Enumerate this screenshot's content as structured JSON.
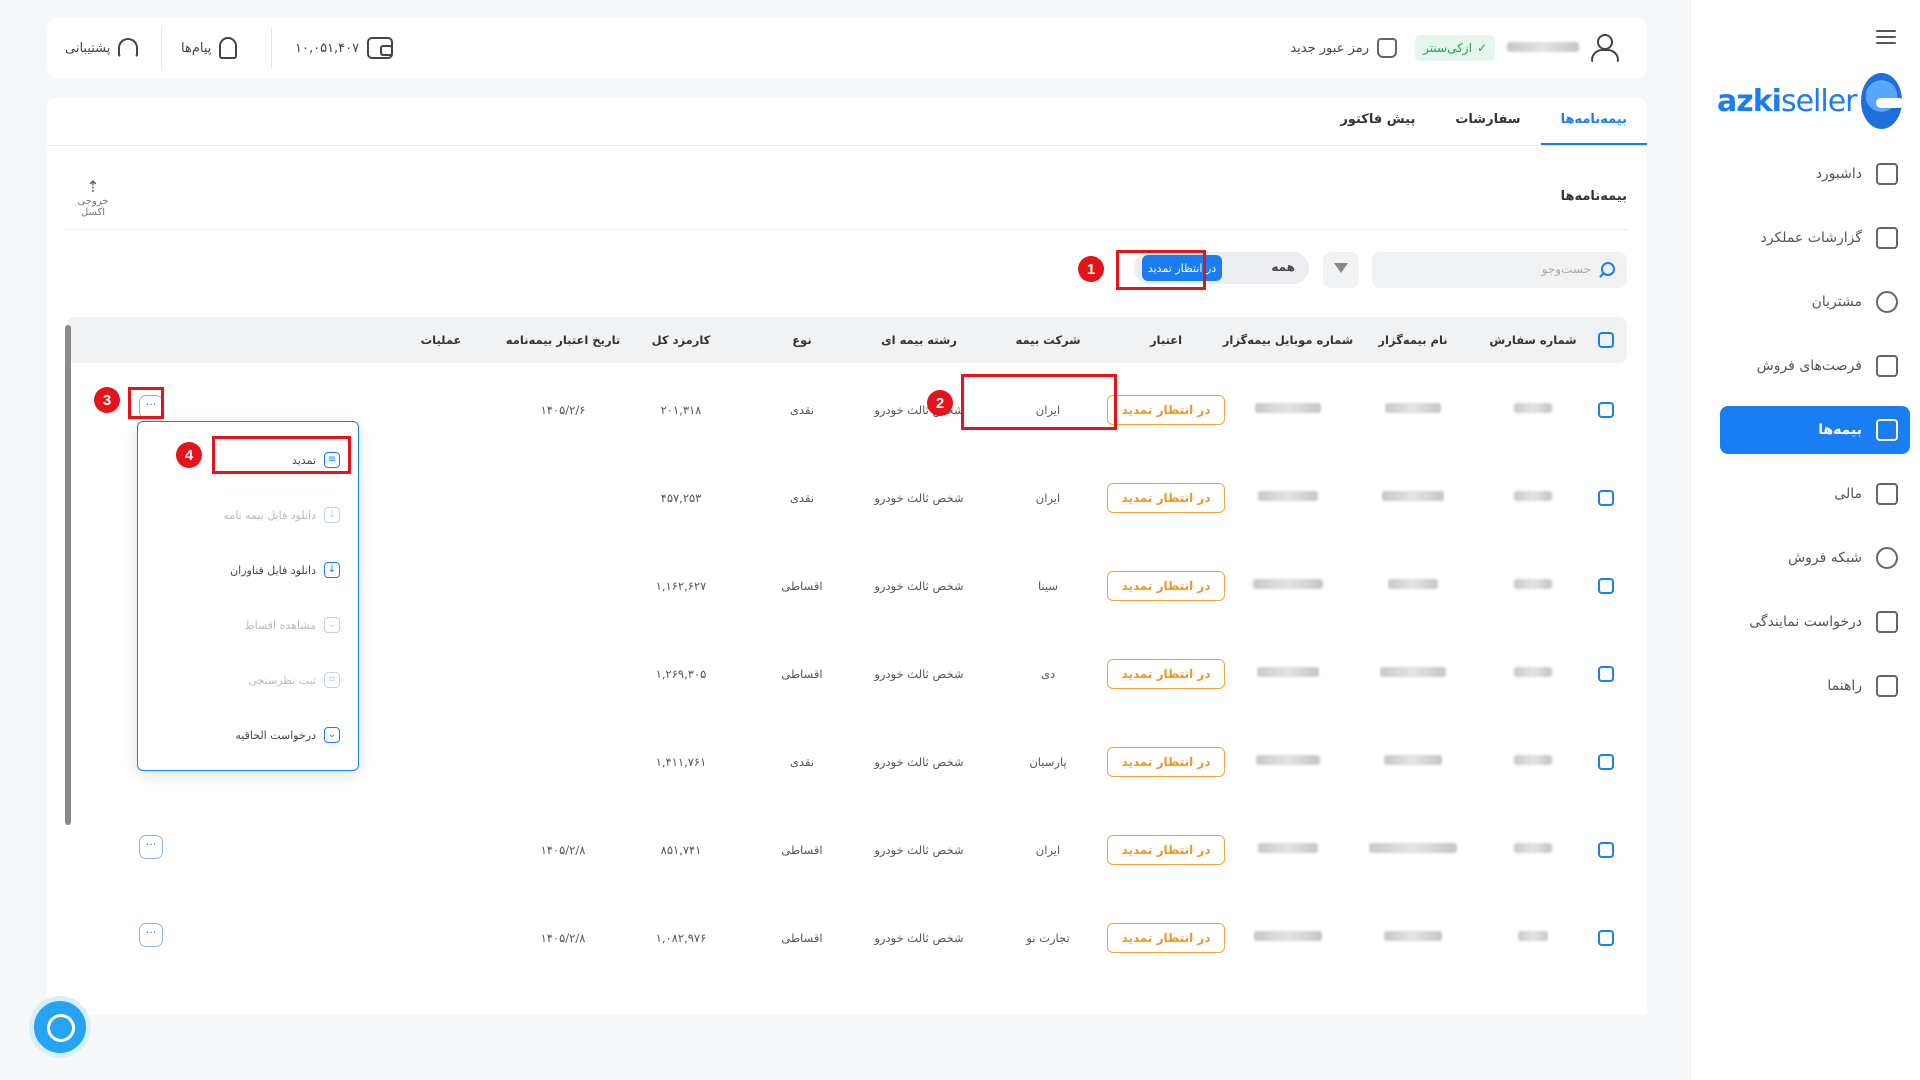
{
  "sidebar": {
    "logo_text_bold": "azki",
    "logo_text": "seller",
    "items": [
      {
        "label": "داشبورد",
        "icon": "dashboard-icon"
      },
      {
        "label": "گزارشات عملکرد",
        "icon": "chart-icon"
      },
      {
        "label": "مشتریان",
        "icon": "users-icon"
      },
      {
        "label": "فرصت‌های فروش",
        "icon": "document-icon"
      },
      {
        "label": "بیمه‌ها",
        "icon": "shield-icon",
        "active": true
      },
      {
        "label": "مالی",
        "icon": "wallet-icon"
      },
      {
        "label": "شبکه فروش",
        "icon": "network-icon"
      },
      {
        "label": "درخواست نمایندگی",
        "icon": "store-icon"
      },
      {
        "label": "راهنما",
        "icon": "help-icon"
      }
    ]
  },
  "topbar": {
    "azki_center": "ازکی‌سنتر",
    "new_password": "رمز عبور جدید",
    "balance": "۱۰,۰۵۱,۴۰۷",
    "messages": "پیام‌ها",
    "support": "پشتیبانی"
  },
  "tabs": [
    "بیمه‌نامه‌ها",
    "سفارشات",
    "پیش فاکتور"
  ],
  "section_title": "بیمه‌نامه‌ها",
  "export_label": "خروجی اکسل",
  "search_placeholder": "جست‌وجو",
  "segment": {
    "all": "همه",
    "pending": "در انتظار تمدید"
  },
  "columns": [
    "شماره سفارش",
    "نام بیمه‌گزار",
    "شماره موبایل بیمه‌گزار",
    "اعتبار",
    "شرکت بیمه",
    "رشته بیمه ای",
    "نوع",
    "کارمزد کل",
    "تاریخ اعتبار بیمه‌نامه",
    "عملیات"
  ],
  "rows": [
    {
      "status": "در انتظار تمدید",
      "company": "ایران",
      "line": "شخص ثالث خودرو",
      "type": "نقدی",
      "fee": "۲۰۱,۳۱۸",
      "date": "۱۴۰۵/۲/۶"
    },
    {
      "status": "در انتظار تمدید",
      "company": "ایران",
      "line": "شخص ثالث خودرو",
      "type": "نقدی",
      "fee": "۴۵۷,۲۵۳",
      "date": ""
    },
    {
      "status": "در انتظار تمدید",
      "company": "سینا",
      "line": "شخص ثالث خودرو",
      "type": "اقساطی",
      "fee": "۱,۱۶۲,۶۲۷",
      "date": ""
    },
    {
      "status": "در انتظار تمدید",
      "company": "دی",
      "line": "شخص ثالث خودرو",
      "type": "اقساطی",
      "fee": "۱,۲۶۹,۳۰۵",
      "date": ""
    },
    {
      "status": "در انتظار تمدید",
      "company": "پارسیان",
      "line": "شخص ثالث خودرو",
      "type": "نقدی",
      "fee": "۱,۴۱۱,۷۶۱",
      "date": ""
    },
    {
      "status": "در انتظار تمدید",
      "company": "ایران",
      "line": "شخص ثالث خودرو",
      "type": "اقساطی",
      "fee": "۸۵۱,۷۴۱",
      "date": "۱۴۰۵/۲/۸"
    },
    {
      "status": "در انتظار تمدید",
      "company": "تجارت نو",
      "line": "شخص ثالث خودرو",
      "type": "اقساطی",
      "fee": "۱,۰۸۲,۹۷۶",
      "date": "۱۴۰۵/۲/۸"
    }
  ],
  "ops_glyph": "···",
  "menu": [
    {
      "label": "تمدید",
      "disabled": false
    },
    {
      "label": "دانلود فایل بیمه نامه",
      "disabled": true
    },
    {
      "label": "دانلود فایل فناوران",
      "disabled": false
    },
    {
      "label": "مشاهده اقساط",
      "disabled": true
    },
    {
      "label": "ثبت نظرسنجی",
      "disabled": true
    },
    {
      "label": "درخواست الحاقیه",
      "disabled": false
    }
  ],
  "annotations": [
    "1",
    "2",
    "3",
    "4"
  ],
  "colors": {
    "accent": "#1a7ef2",
    "status": "#f2951a",
    "highlight": "#e3141a"
  }
}
